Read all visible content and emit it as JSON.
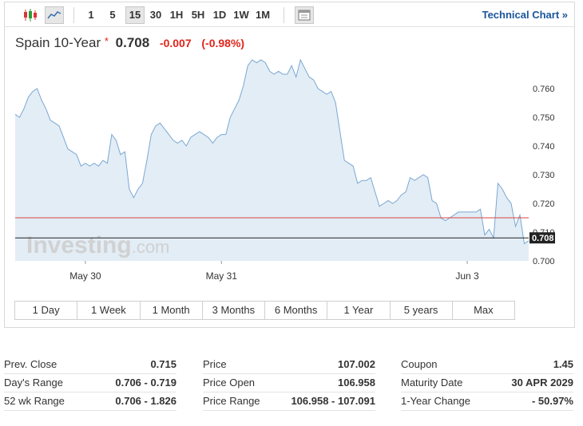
{
  "toolbar": {
    "intervals": [
      "1",
      "5",
      "15",
      "30",
      "1H",
      "5H",
      "1D",
      "1W",
      "1M"
    ],
    "active_interval": "15",
    "technical_chart_link": "Technical Chart »"
  },
  "header": {
    "name": "Spain 10-Year",
    "star": "*",
    "price": "0.708",
    "change": "-0.007",
    "change_pct": "(-0.98%)"
  },
  "chart_data": {
    "type": "area",
    "title": "Spain 10-Year",
    "ylim": [
      0.7,
      0.77
    ],
    "y_ticks": [
      "0.760",
      "0.750",
      "0.740",
      "0.730",
      "0.720",
      "0.710",
      "0.700"
    ],
    "x_ticks": [
      "May 30",
      "May 31",
      "Jun 3"
    ],
    "watermark": "Investing.com",
    "prev_close": 0.715,
    "last_value": 0.708,
    "last_label": "0.708",
    "series": [
      {
        "values": [
          0.751,
          0.75,
          0.753,
          0.757,
          0.759,
          0.76,
          0.756,
          0.753,
          0.749,
          0.748,
          0.747,
          0.743,
          0.739,
          0.738,
          0.737,
          0.733,
          0.734,
          0.733,
          0.734,
          0.733,
          0.735,
          0.734,
          0.744,
          0.742,
          0.737,
          0.738,
          0.725,
          0.722,
          0.725,
          0.727,
          0.735,
          0.744,
          0.747,
          0.748,
          0.746,
          0.744,
          0.742,
          0.741,
          0.742,
          0.74,
          0.743,
          0.744,
          0.745,
          0.744,
          0.743,
          0.741,
          0.743,
          0.744,
          0.744,
          0.75,
          0.753,
          0.756,
          0.761,
          0.768,
          0.77,
          0.769,
          0.77,
          0.769,
          0.766,
          0.765,
          0.766,
          0.765,
          0.765,
          0.768,
          0.764,
          0.77,
          0.767,
          0.764,
          0.763,
          0.76,
          0.759,
          0.758,
          0.759,
          0.755,
          0.745,
          0.735,
          0.734,
          0.733,
          0.727,
          0.728,
          0.728,
          0.729,
          0.724,
          0.719,
          0.72,
          0.721,
          0.72,
          0.721,
          0.723,
          0.724,
          0.729,
          0.728,
          0.729,
          0.73,
          0.729,
          0.721,
          0.72,
          0.715,
          0.714,
          0.715,
          0.716,
          0.717,
          0.717,
          0.717,
          0.717,
          0.717,
          0.718,
          0.709,
          0.711,
          0.708,
          0.727,
          0.725,
          0.722,
          0.72,
          0.712,
          0.716,
          0.706,
          0.707
        ]
      }
    ],
    "colors": {
      "line": "#7aa7d4",
      "area": "#e3edf5",
      "prev_close_line": "#d64545",
      "last_line": "#222222",
      "last_label_bg": "#222222"
    }
  },
  "ranges": [
    "1 Day",
    "1 Week",
    "1 Month",
    "3 Months",
    "6 Months",
    "1 Year",
    "5 years",
    "Max"
  ],
  "stats": {
    "col1": [
      {
        "label": "Prev. Close",
        "value": "0.715"
      },
      {
        "label": "Day's Range",
        "value": "0.706 - 0.719"
      },
      {
        "label": "52 wk Range",
        "value": "0.706 - 1.826"
      }
    ],
    "col2": [
      {
        "label": "Price",
        "value": "107.002"
      },
      {
        "label": "Price Open",
        "value": "106.958"
      },
      {
        "label": "Price Range",
        "value": "106.958 - 107.091"
      }
    ],
    "col3": [
      {
        "label": "Coupon",
        "value": "1.45"
      },
      {
        "label": "Maturity Date",
        "value": "30 APR 2029"
      },
      {
        "label": "1-Year Change",
        "value": "- 50.97%"
      }
    ]
  },
  "icons": {
    "candlestick": "candlestick-chart-icon",
    "area": "area-chart-icon",
    "calendar": "calendar-icon"
  }
}
